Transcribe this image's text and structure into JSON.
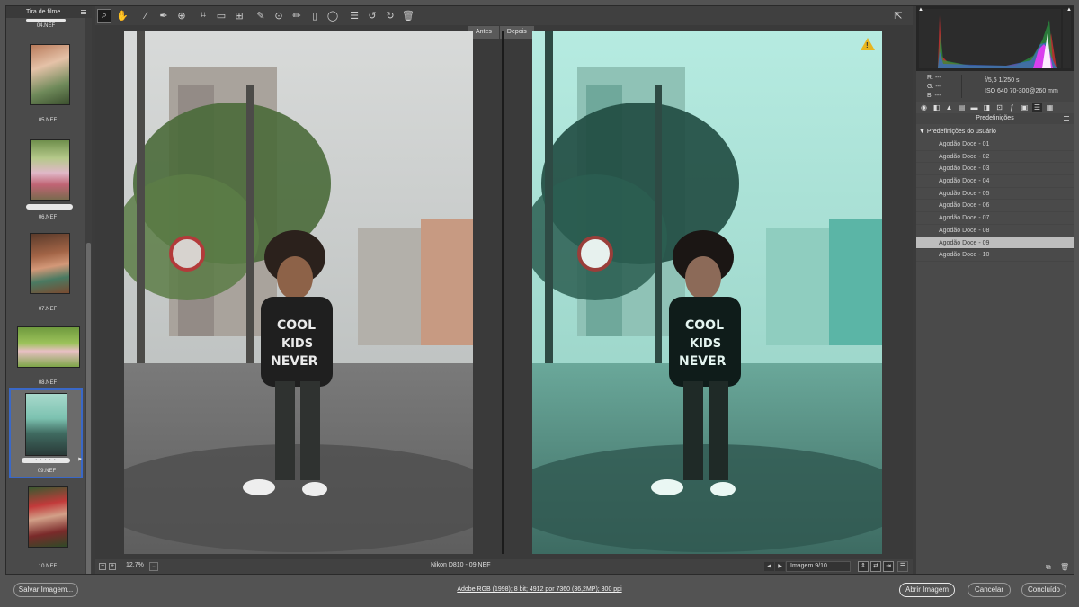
{
  "filmstrip": {
    "title": "Tira de filme",
    "top_label": "04.NEF",
    "items": [
      {
        "label": "05.NEF"
      },
      {
        "label": "06.NEF"
      },
      {
        "label": "07.NEF"
      },
      {
        "label": "08.NEF"
      },
      {
        "label": "09.NEF",
        "rating": "• • • • •"
      },
      {
        "label": "10.NEF"
      }
    ],
    "selected": "09.NEF"
  },
  "toolbar": {
    "tools": [
      "zoom-icon",
      "hand-icon",
      "white-balance-icon",
      "color-sampler-icon",
      "target-adjust-icon",
      "crop-icon",
      "straighten-icon",
      "transform-icon",
      "spot-removal-icon",
      "red-eye-icon",
      "adjustment-brush-icon",
      "graduated-filter-icon",
      "radial-filter-icon",
      "preferences-icon",
      "rotate-left-icon",
      "rotate-right-icon",
      "trash-icon"
    ],
    "active_tool": "zoom-icon"
  },
  "preview": {
    "before_label": "Antes",
    "after_label": "Depois"
  },
  "status": {
    "zoom": "12,7%",
    "camera_file": "Nikon D810  -  09.NEF",
    "image_count": "Imagem 9/10"
  },
  "info": {
    "r": "R:     ---",
    "g": "G:     ---",
    "b": "B:     ---",
    "exif_line1": "f/5,6     1/250 s",
    "exif_line2": "ISO 640   70-300@260 mm"
  },
  "presets_panel": {
    "title": "Predefinições",
    "group": "▼  Predefinições do usuário",
    "items": [
      "Agodão Doce - 01",
      "Agodão Doce - 02",
      "Agodão Doce - 03",
      "Agodão Doce - 04",
      "Agodão Doce - 05",
      "Agodão Doce - 06",
      "Agodão Doce - 07",
      "Agodão Doce - 08",
      "Agodão Doce - 09",
      "Agodão Doce - 10"
    ],
    "selected": "Agodão Doce - 09"
  },
  "bottom": {
    "save_label": "Salvar Imagem...",
    "workflow_link": "Adobe RGB (1998); 8 bit; 4912 por 7360 (36,2MP); 300 ppi",
    "open_label": "Abrir Imagem",
    "cancel_label": "Cancelar",
    "done_label": "Concluído"
  },
  "colors": {
    "accent": "#3a68c7",
    "warning": "#e8b51f",
    "panel": "#4a4a4a",
    "background": "#535353"
  }
}
